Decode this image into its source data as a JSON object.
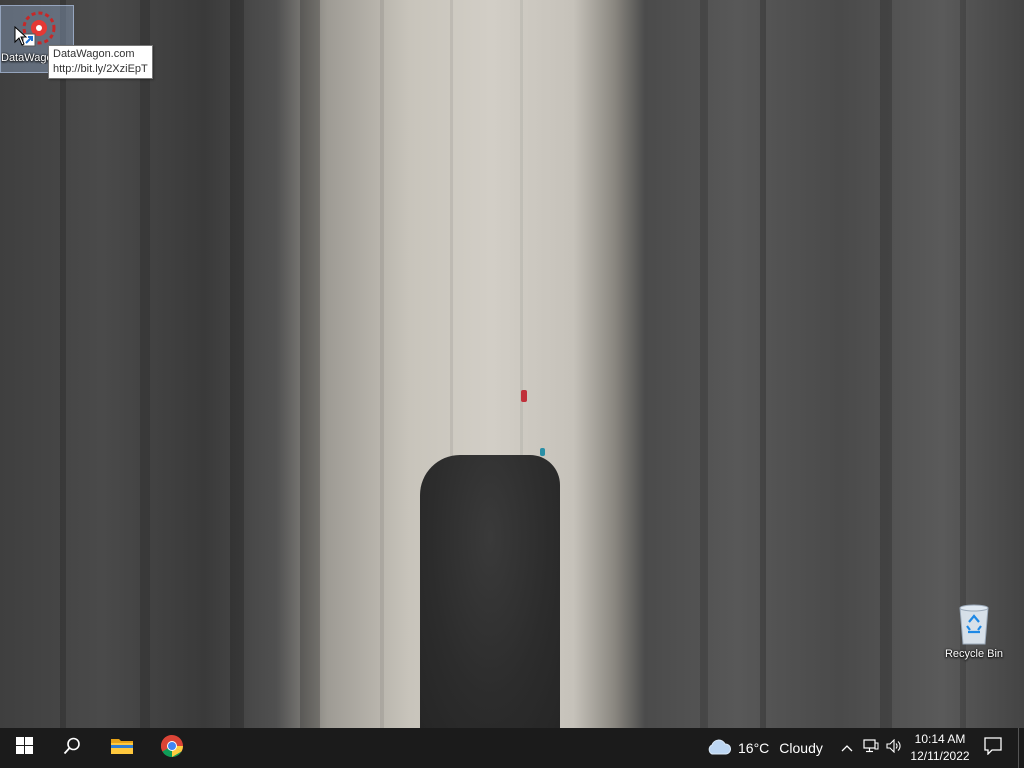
{
  "desktop": {
    "icons": [
      {
        "label": "DataWagon.com",
        "icon": "datawagon-icon"
      },
      {
        "label": "Recycle Bin",
        "icon": "recycle-bin-icon"
      }
    ],
    "tooltip": {
      "line1": "DataWagon.com",
      "line2": "http://bit.ly/2XziEpT"
    }
  },
  "taskbar": {
    "pinned": [
      {
        "name": "start",
        "icon": "windows-logo-icon"
      },
      {
        "name": "search",
        "icon": "search-icon"
      },
      {
        "name": "file-explorer",
        "icon": "folder-icon"
      },
      {
        "name": "chrome",
        "icon": "chrome-icon"
      }
    ],
    "weather": {
      "icon": "cloud-icon",
      "temp": "16°C",
      "condition": "Cloudy"
    },
    "tray": [
      "chevron-up-icon",
      "network-icon",
      "volume-icon"
    ],
    "clock": {
      "time": "10:14 AM",
      "date": "12/11/2022"
    },
    "notification_icon": "notification-icon"
  },
  "colors": {
    "taskbar": "#1b1b1b",
    "selection": "#a0bee6"
  }
}
